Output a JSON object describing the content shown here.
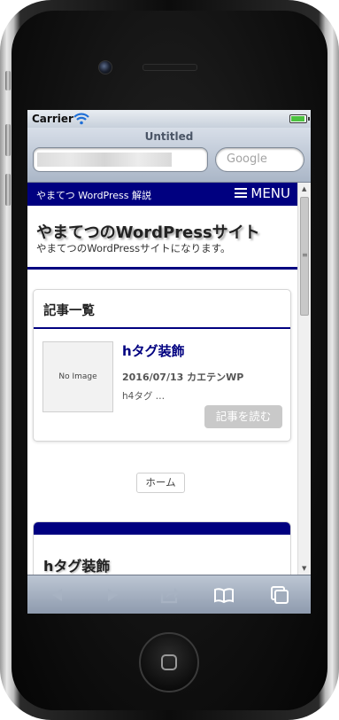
{
  "status_bar": {
    "carrier": "Carrier"
  },
  "browser": {
    "page_title": "Untitled",
    "search_placeholder": "Google"
  },
  "site": {
    "nav_title": "やまてつ WordPress 解説",
    "menu_label": "MENU",
    "title": "やまてつのWordPressサイト",
    "description": "やまてつのWordPressサイトになります。"
  },
  "article_list": {
    "heading": "記事一覧",
    "items": [
      {
        "thumbnail": "No Image",
        "title": "hタグ装飾",
        "meta": "2016/07/13 カエテンWP",
        "excerpt": "h4タグ …",
        "read_more": "記事を読む"
      }
    ]
  },
  "home_link": "ホーム",
  "next_section": {
    "title": "hタグ装飾"
  },
  "colors": {
    "accent": "#000080",
    "button_gray": "#c9c9c9"
  },
  "icons": [
    "wifi-icon",
    "battery-icon",
    "menu-icon",
    "back-icon",
    "forward-icon",
    "share-icon",
    "bookmarks-icon",
    "tabs-icon"
  ]
}
